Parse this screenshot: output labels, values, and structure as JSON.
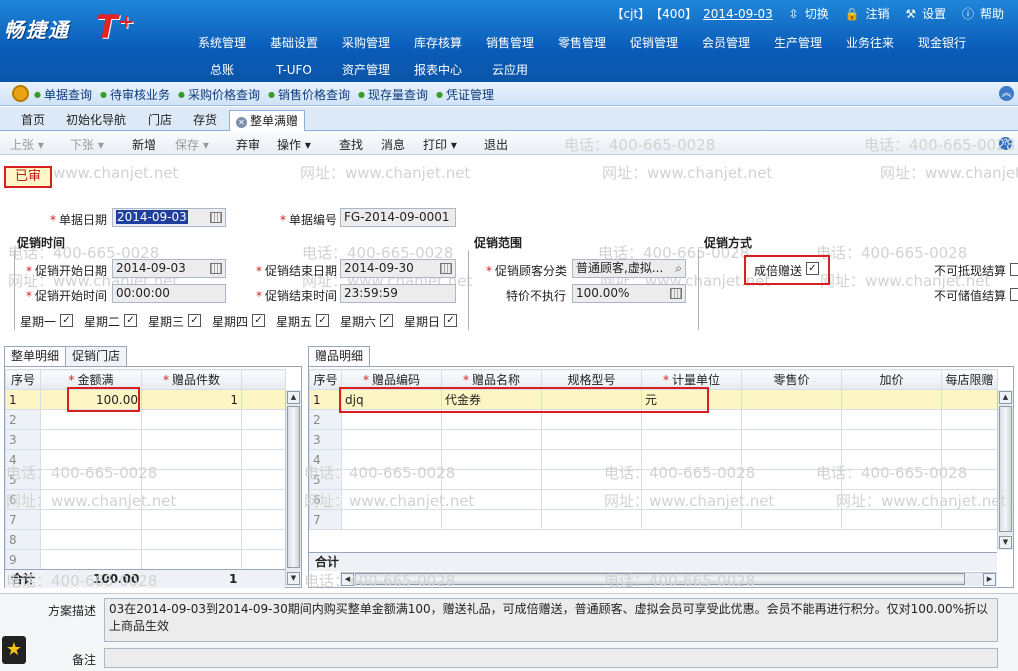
{
  "header": {
    "logo_text": "畅捷通",
    "logo_t": "T⁺",
    "user": "【cjt】",
    "account": "【400】",
    "date": "2014-09-03",
    "switch_label": "切换",
    "logout_label": "注销",
    "settings_label": "设置",
    "help_label": "帮助"
  },
  "menu": {
    "row1": [
      "系统管理",
      "基础设置",
      "采购管理",
      "库存核算",
      "销售管理",
      "零售管理",
      "促销管理",
      "会员管理",
      "生产管理",
      "业务往来",
      "现金银行"
    ],
    "row2": [
      "总账",
      "T-UFO",
      "资产管理",
      "报表中心",
      "云应用"
    ]
  },
  "quickbar": [
    "单据查询",
    "待审核业务",
    "采购价格查询",
    "销售价格查询",
    "现存量查询",
    "凭证管理"
  ],
  "tabs": [
    "首页",
    "初始化导航",
    "门店",
    "存货",
    "整单满赠"
  ],
  "toolbar": {
    "prev": "上张",
    "next": "下张",
    "new": "新增",
    "save": "保存",
    "abandon": "弃审",
    "operate": "操作",
    "find": "查找",
    "message": "消息",
    "print": "打印",
    "exit": "退出"
  },
  "status": "已审",
  "watermark_phone": "电话：400-665-0028",
  "watermark_web": "网址：www.chanjet.net",
  "form": {
    "doc_date_label": "单据日期",
    "doc_date": "2014-09-03",
    "doc_no_label": "单据编号",
    "doc_no": "FG-2014-09-0001",
    "time_section": "促销时间",
    "range_section": "促销范围",
    "method_section": "促销方式",
    "start_date_label": "促销开始日期",
    "start_date": "2014-09-03",
    "end_date_label": "促销结束日期",
    "end_date": "2014-09-30",
    "start_time_label": "促销开始时间",
    "start_time": "00:00:00",
    "end_time_label": "促销结束时间",
    "end_time": "23:59:59",
    "customer_class_label": "促销顾客分类",
    "customer_class": "普通顾客,虚拟...",
    "special_price_label": "特价不执行",
    "special_price": "100.00%",
    "multiple_gift_label": "成倍赠送",
    "no_cash_label": "不可抵现结算",
    "no_stored_label": "不可储值结算",
    "weekdays": [
      "星期一",
      "星期二",
      "星期三",
      "星期四",
      "星期五",
      "星期六",
      "星期日"
    ]
  },
  "left_grid": {
    "tabs": [
      "整单明细",
      "促销门店"
    ],
    "headers": [
      "序号",
      "金额满",
      "赠品件数"
    ],
    "rows": [
      [
        "1",
        "100.00",
        "1"
      ]
    ],
    "footer_label": "合计",
    "footer_amount": "100.00",
    "footer_count": "1"
  },
  "right_grid": {
    "tabs": [
      "赠品明细"
    ],
    "headers": [
      "序号",
      "赠品编码",
      "赠品名称",
      "规格型号",
      "计量单位",
      "零售价",
      "加价",
      "每店限赠"
    ],
    "rows": [
      [
        "1",
        "djq",
        "代金券",
        "",
        "元",
        "",
        "",
        ""
      ]
    ],
    "footer_label": "合计"
  },
  "bottom": {
    "desc_label": "方案描述",
    "desc": "03在2014-09-03到2014-09-30期间内购买整单金额满100，赠送礼品，可成倍赠送，普通顾客、虚拟会员可享受此优惠。会员不能再进行积分。仅对100.00%折以上商品生效",
    "note_label": "备注",
    "favorites_icon": "★"
  }
}
